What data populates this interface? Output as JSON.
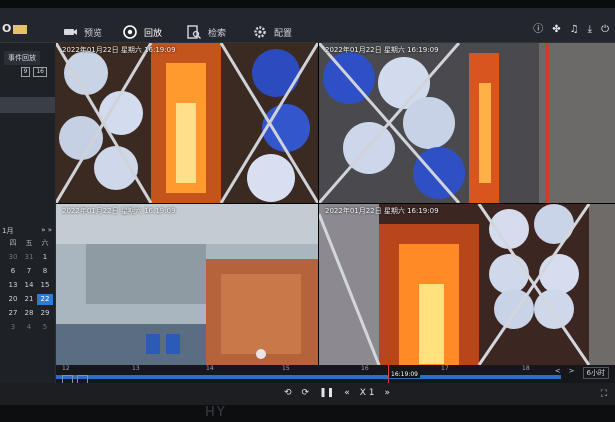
{
  "app": {
    "logo_text": "O"
  },
  "nav": [
    {
      "label": "预览",
      "icon": "camera-icon"
    },
    {
      "label": "回放",
      "icon": "playback-icon"
    },
    {
      "label": "检索",
      "icon": "search-file-icon"
    },
    {
      "label": "配置",
      "icon": "gear-icon"
    }
  ],
  "top_icons": [
    "info-icon",
    "fan-icon",
    "bell-icon",
    "download-icon",
    "power-icon"
  ],
  "sidebar": {
    "title": "事件回放",
    "chips": [
      "9",
      "16"
    ],
    "calendar": {
      "month_label": "1月",
      "next_label": "» »",
      "weekday_headers": [
        "四",
        "五",
        "六"
      ],
      "days": [
        {
          "d": "30",
          "dim": true
        },
        {
          "d": "31",
          "dim": true
        },
        {
          "d": "1",
          "dim": false
        },
        {
          "d": "6",
          "dim": false
        },
        {
          "d": "7",
          "dim": false
        },
        {
          "d": "8",
          "dim": false
        },
        {
          "d": "13",
          "dim": false
        },
        {
          "d": "14",
          "dim": false
        },
        {
          "d": "15",
          "dim": false
        },
        {
          "d": "20",
          "dim": false
        },
        {
          "d": "21",
          "dim": false
        },
        {
          "d": "22",
          "dim": false,
          "selected": true
        },
        {
          "d": "27",
          "dim": false
        },
        {
          "d": "28",
          "dim": false
        },
        {
          "d": "29",
          "dim": false
        },
        {
          "d": "3",
          "dim": true
        },
        {
          "d": "4",
          "dim": true
        },
        {
          "d": "5",
          "dim": true
        }
      ]
    }
  },
  "cameras": [
    {
      "osd": "2022年01月22日 星期六 16:19:09"
    },
    {
      "osd": "2022年01月22日 星期六 16:19:09"
    },
    {
      "osd": "2022年01月22日 星期六 16:19:09"
    },
    {
      "osd": "2022年01月22日 星期六 16:19:09"
    }
  ],
  "timeline": {
    "ticks": [
      "12",
      "13",
      "14",
      "15",
      "16",
      "17",
      "18"
    ],
    "cursor_time": "16:19:09",
    "span_label": "6小时",
    "nav_prev": "<",
    "nav_next": ">"
  },
  "controls": {
    "speed_label": "X 1"
  },
  "bezel_brand": "HY"
}
